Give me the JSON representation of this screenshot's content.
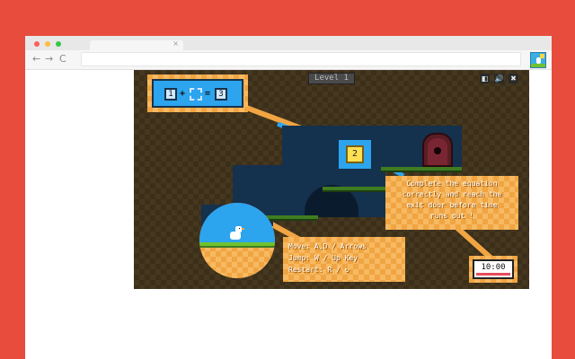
{
  "colors": {
    "background": "#e74c3c",
    "browser_chrome": "#e8e8e8",
    "sky": "#2ca4ee",
    "platform": "#14314e",
    "grass": "#6fc22e",
    "accent_orange": "#f0a542",
    "door": "#5b1d25",
    "number_block": "#ffe053"
  },
  "browser": {
    "tab_close": "×",
    "back_icon": "←",
    "forward_icon": "→",
    "reload_icon": "C",
    "extension_icon": "duck-game-icon"
  },
  "game": {
    "level_label": "Level 1",
    "buttons": [
      {
        "name": "pause-icon",
        "glyph": "◧"
      },
      {
        "name": "sound-icon",
        "glyph": "🔊"
      },
      {
        "name": "close-icon",
        "glyph": "✖"
      }
    ],
    "equation": {
      "left": "1",
      "plus": "+",
      "equals": "=",
      "result": "3"
    },
    "number_block": "2",
    "instructions": "Complete the equation\ncorrectly and reach the\nexit door before time\nruns out !",
    "controls": {
      "move": "Move:  A,D / Arrows",
      "jump": "Jump:  W / Up Key",
      "restart": "Restart:  R / ↻"
    },
    "timer": {
      "text": "10:00",
      "remaining": 1.0
    }
  }
}
